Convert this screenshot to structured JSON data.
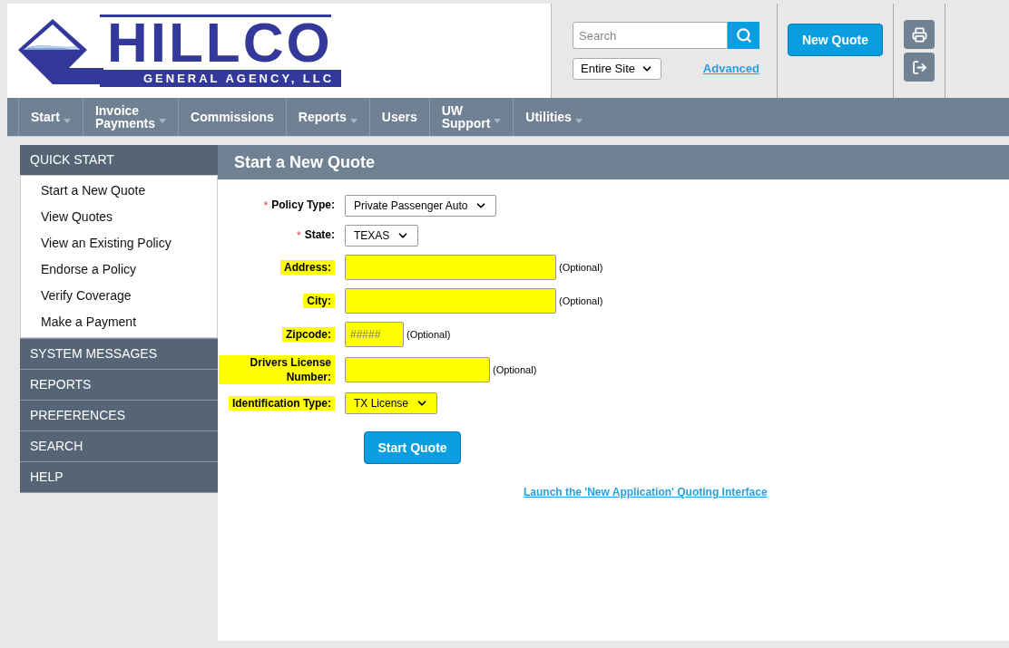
{
  "logo": {
    "name": "HILLCO",
    "tagline": "GENERAL AGENCY, LLC"
  },
  "search": {
    "placeholder": "Search",
    "scope": "Entire Site",
    "advanced": "Advanced"
  },
  "new_quote_button": "New Quote",
  "nav": [
    {
      "label": "Start",
      "dropdown": true
    },
    {
      "label": "Invoice Payments",
      "dropdown": true
    },
    {
      "label": "Commissions",
      "dropdown": false
    },
    {
      "label": "Reports",
      "dropdown": true
    },
    {
      "label": "Users",
      "dropdown": false
    },
    {
      "label": "UW Support",
      "dropdown": true
    },
    {
      "label": "Utilities",
      "dropdown": true
    }
  ],
  "sidebar": [
    {
      "title": "QUICK START",
      "children": [
        {
          "label": "Start a New Quote"
        },
        {
          "label": "View Quotes"
        },
        {
          "label": "View an Existing Policy"
        },
        {
          "label": "Endorse a Policy"
        },
        {
          "label": "Verify Coverage"
        },
        {
          "label": "Make a Payment"
        }
      ]
    },
    {
      "title": "SYSTEM MESSAGES"
    },
    {
      "title": "REPORTS"
    },
    {
      "title": "PREFERENCES"
    },
    {
      "title": "SEARCH"
    },
    {
      "title": "HELP"
    }
  ],
  "main": {
    "title": "Start a New Quote",
    "fields": [
      {
        "kind": "select",
        "required_mark": "*",
        "label": "Policy Type:",
        "highlighted": false,
        "value": "Private Passenger Auto"
      },
      {
        "kind": "select",
        "required_mark": "*",
        "label": "State:",
        "highlighted": false,
        "value": "TEXAS"
      },
      {
        "kind": "wide",
        "label": "Address:",
        "highlighted": true,
        "note": "(Optional)"
      },
      {
        "kind": "wide",
        "label": "City:",
        "highlighted": true,
        "note": "(Optional)"
      },
      {
        "kind": "short",
        "label": "Zipcode:",
        "highlighted": true,
        "placeholder": "#####",
        "note": "(Optional)"
      },
      {
        "kind": "medium",
        "label": "Drivers License Number:",
        "highlighted": true,
        "note": "(Optional)"
      },
      {
        "kind": "select",
        "label": "Identification Type:",
        "highlighted": true,
        "value": "TX License"
      }
    ],
    "submit": "Start Quote",
    "link": "Launch the 'New Application' Quoting Interface"
  }
}
